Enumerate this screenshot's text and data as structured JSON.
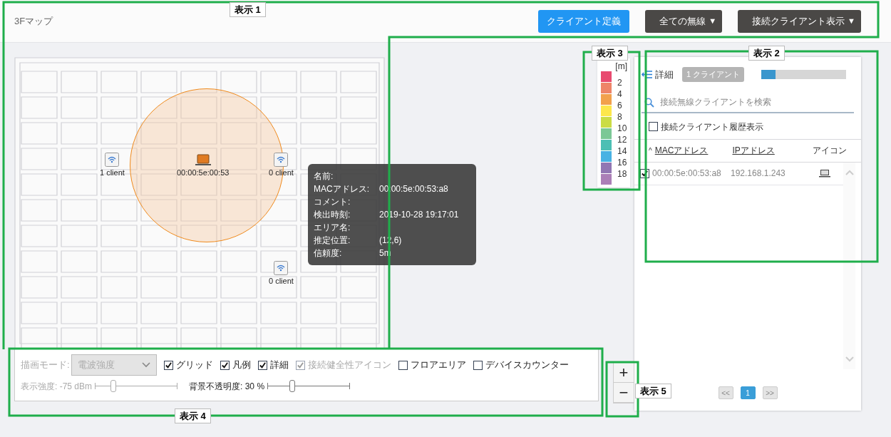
{
  "header": {
    "title": "3Fマップ",
    "buttons": [
      {
        "label": "クライアント定義",
        "kind": "primary"
      },
      {
        "label": "全ての無線",
        "kind": "dropdown",
        "caret": "▼"
      },
      {
        "label": "接続クライアント表示",
        "kind": "dropdown",
        "caret": "▼"
      }
    ]
  },
  "map": {
    "access_points": [
      {
        "label": "1 client"
      },
      {
        "label": "0 client"
      },
      {
        "label": "0 client"
      }
    ],
    "client": {
      "label": "00:00:5e:00:53"
    },
    "tooltip": {
      "rows": [
        {
          "key": "名前:"
        },
        {
          "key": "MACアドレス:",
          "value": "00:00:5e:00:53:a8"
        },
        {
          "key": "コメント:"
        },
        {
          "key": "検出時刻:",
          "value": "2019-10-28 19:17:01"
        },
        {
          "key": "エリア名:"
        },
        {
          "key": "推定位置:",
          "value": "(12,6)"
        },
        {
          "key": "信頼度:",
          "value": "5m"
        }
      ]
    }
  },
  "legend": {
    "unit": "[m]",
    "items": [
      {
        "color": "#e84a6f",
        "label": "2"
      },
      {
        "color": "#ee8468",
        "label": "4"
      },
      {
        "color": "#f2a14c",
        "label": "6"
      },
      {
        "color": "#fde74c",
        "label": "8"
      },
      {
        "color": "#cbdc45",
        "label": "10"
      },
      {
        "color": "#7bc896",
        "label": "12"
      },
      {
        "color": "#4dbfb4",
        "label": "14"
      },
      {
        "color": "#48b2e3",
        "label": "16"
      },
      {
        "color": "#9177b3",
        "label": "18"
      },
      {
        "color": "#ab7fb7"
      }
    ]
  },
  "controls": {
    "mode": {
      "label": "描画モード:",
      "value": "電波強度",
      "disabled": true
    },
    "checkboxes": [
      {
        "label": "グリッド",
        "checked": true,
        "disabled": false
      },
      {
        "label": "凡例",
        "checked": true,
        "disabled": false
      },
      {
        "label": "詳細",
        "checked": true,
        "disabled": false
      },
      {
        "label": "接続健全性アイコン",
        "checked": true,
        "disabled": true
      },
      {
        "label": "フロアエリア",
        "checked": false,
        "disabled": false
      },
      {
        "label": "デバイスカウンター",
        "checked": false,
        "disabled": false
      }
    ],
    "sliders": [
      {
        "label": "表示強度: -75 dBm",
        "level": 0.22,
        "disabled": true
      },
      {
        "label": "背景不透明度: 30 %",
        "level": 0.3,
        "disabled": false
      }
    ]
  },
  "zoom": {
    "buttons": [
      "+",
      "−"
    ]
  },
  "details": {
    "title": "詳細",
    "badge": "1 クライアント",
    "progress": {
      "level": 0.17
    },
    "search": {
      "placeholder": "接続無線クライアントを検索"
    },
    "history": {
      "label": "接続クライアント履歴表示",
      "checked": false
    },
    "columns": [
      {
        "label": "MACアドレス",
        "sort": "^",
        "link": true
      },
      {
        "label": "IPアドレス",
        "link": true
      },
      {
        "label": "アイコン",
        "link": false
      }
    ],
    "rows": [
      {
        "checked": true,
        "mac": "00:00:5e:00:53:a8",
        "ip": "192.168.1.243"
      }
    ],
    "pages": [
      {
        "label": "<<",
        "selected": false
      },
      {
        "label": "1",
        "selected": true
      },
      {
        "label": ">>",
        "selected": false
      }
    ]
  },
  "annotations": [
    {
      "label": "表示 1"
    },
    {
      "label": "表示 2"
    },
    {
      "label": "表示 3"
    },
    {
      "label": "表示 4"
    },
    {
      "label": "表示 5"
    }
  ]
}
